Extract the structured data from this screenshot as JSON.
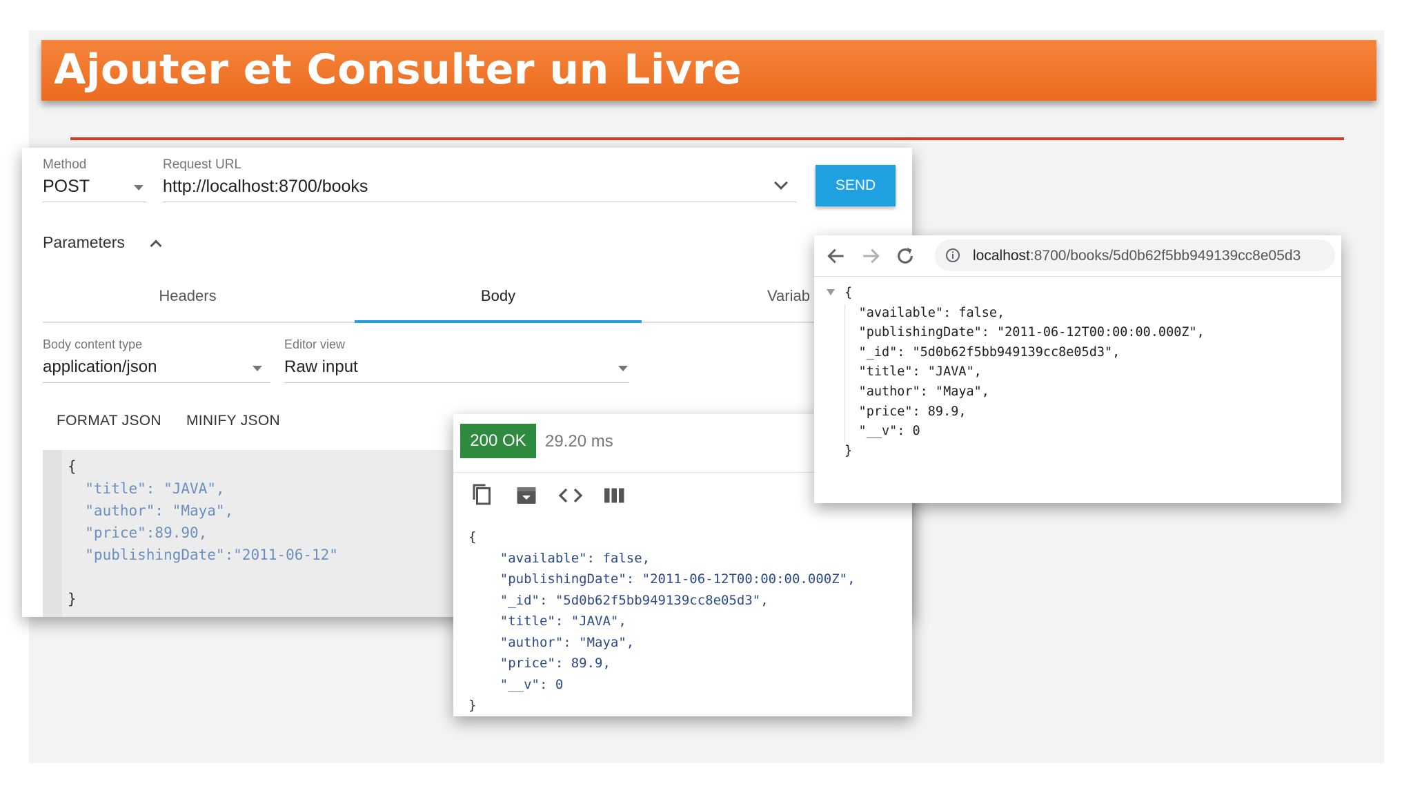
{
  "slide": {
    "title": "Ajouter et Consulter un Livre"
  },
  "request": {
    "method_label": "Method",
    "method_value": "POST",
    "url_label": "Request URL",
    "url_value": "http://localhost:8700/books",
    "send_label": "SEND",
    "parameters_label": "Parameters",
    "tabs": [
      {
        "label": "Headers"
      },
      {
        "label": "Body"
      },
      {
        "label": "Variab"
      }
    ],
    "body_content_type_label": "Body content type",
    "body_content_type_value": "application/json",
    "editor_view_label": "Editor view",
    "editor_view_value": "Raw input",
    "format_json_label": "FORMAT JSON",
    "minify_json_label": "MINIFY JSON",
    "body_lines": [
      "{",
      "  \"title\": \"JAVA\",",
      "  \"author\": \"Maya\",",
      "  \"price\":89.90,",
      "  \"publishingDate\":\"2011-06-12\"",
      "",
      "}"
    ]
  },
  "response": {
    "status": "200 OK",
    "elapsed": "29.20 ms",
    "icons": [
      "copy-icon",
      "save-icon",
      "code-icon",
      "columns-icon"
    ],
    "lines": [
      "{",
      "    \"available\": false,",
      "    \"publishingDate\": \"2011-06-12T00:00:00.000Z\",",
      "    \"_id\": \"5d0b62f5bb949139cc8e05d3\",",
      "    \"title\": \"JAVA\",",
      "    \"author\": \"Maya\",",
      "    \"price\": 89.9,",
      "    \"__v\": 0",
      "}"
    ]
  },
  "browser": {
    "address_host": "localhost",
    "address_path": ":8700/books/5d0b62f5bb949139cc8e05d3",
    "lines": [
      "{",
      "    \"available\": false,",
      "    \"publishingDate\": \"2011-06-12T00:00:00.000Z\",",
      "    \"_id\": \"5d0b62f5bb949139cc8e05d3\",",
      "    \"title\": \"JAVA\",",
      "    \"author\": \"Maya\",",
      "    \"price\": 89.9,",
      "    \"__v\": 0",
      "}"
    ]
  },
  "colors": {
    "banner": "#ef7428",
    "send_button": "#1fa0e0",
    "status_ok": "#2e8b3e",
    "rule": "#d93a2b"
  }
}
